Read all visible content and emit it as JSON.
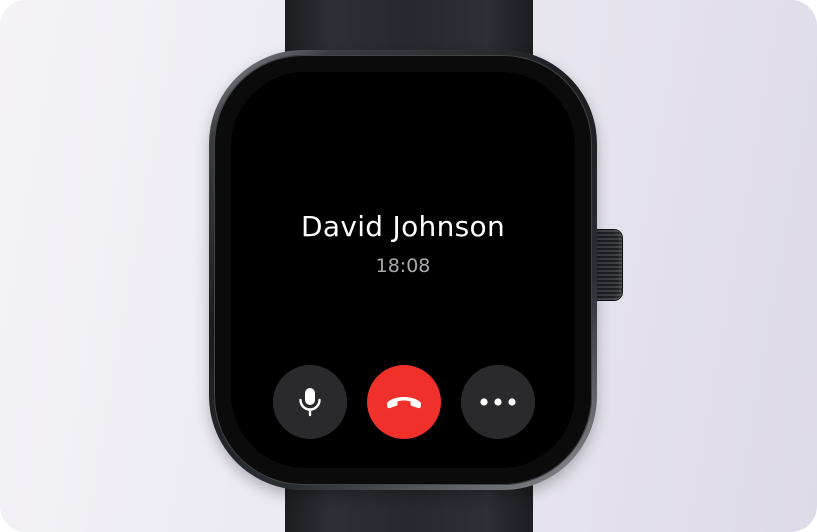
{
  "call": {
    "caller_name": "David Johnson",
    "elapsed_time": "18:08"
  },
  "controls": {
    "mute": {
      "icon": "microphone-icon"
    },
    "end_call": {
      "icon": "end-call-icon",
      "color": "#f0302b"
    },
    "more": {
      "icon": "more-horizontal-icon"
    }
  },
  "theme": {
    "screen_background": "#000000",
    "button_background": "#2a2a2c",
    "text_primary": "#ffffff",
    "text_secondary": "#a9a9ad"
  }
}
